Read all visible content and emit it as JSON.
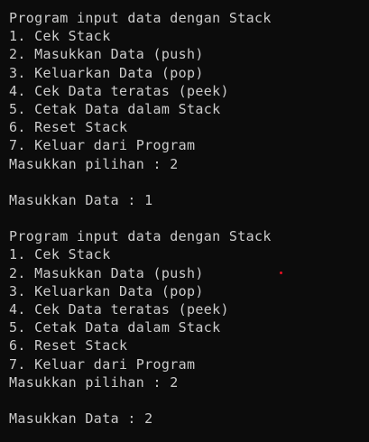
{
  "console": {
    "text_color": "#cccccc",
    "background_color": "#0c0c0c",
    "cursor_color": "#e81123",
    "lines": [
      "Program input data dengan Stack",
      "1. Cek Stack",
      "2. Masukkan Data (push)",
      "3. Keluarkan Data (pop)",
      "4. Cek Data teratas (peek)",
      "5. Cetak Data dalam Stack",
      "6. Reset Stack",
      "7. Keluar dari Program",
      "Masukkan pilihan : 2",
      "",
      "Masukkan Data : 1",
      "",
      "Program input data dengan Stack",
      "1. Cek Stack",
      "2. Masukkan Data (push)",
      "3. Keluarkan Data (pop)",
      "4. Cek Data teratas (peek)",
      "5. Cetak Data dalam Stack",
      "6. Reset Stack",
      "7. Keluar dari Program",
      "Masukkan pilihan : 2",
      "",
      "Masukkan Data : 2"
    ]
  }
}
